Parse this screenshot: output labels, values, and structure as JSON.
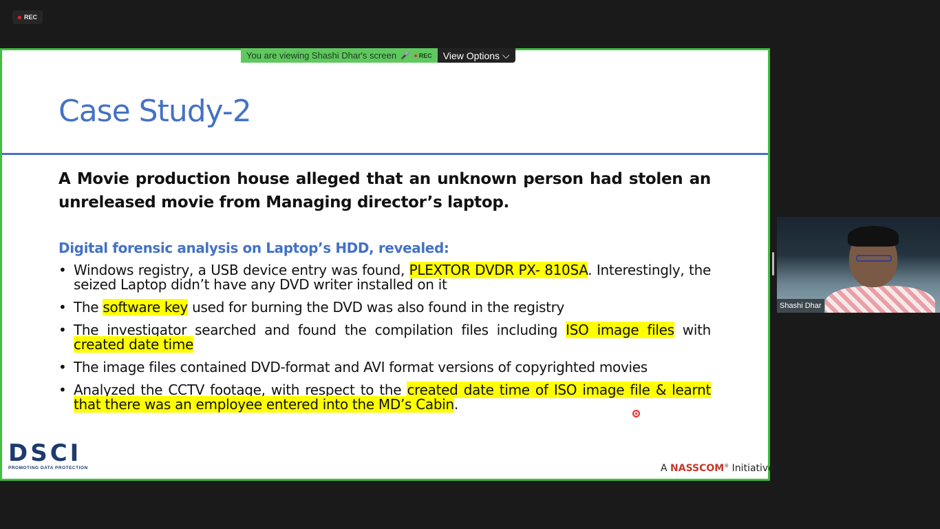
{
  "recording": {
    "label": "REC"
  },
  "share_bar": {
    "viewing_text": "You are viewing Shashi Dhar's screen",
    "rec_label": "REC",
    "view_options_label": "View Options",
    "view_options_chevron": "⌵"
  },
  "slide": {
    "title": "Case Study-2",
    "intro": "A Movie production house alleged that an unknown person had stolen an unreleased movie from Managing director’s laptop.",
    "subheading": "Digital forensic analysis on Laptop’s HDD, revealed:",
    "bullets": [
      {
        "a": "Windows registry, a USB device entry was found, ",
        "hl": "PLEXTOR DVDR PX- 810SA",
        "b": ". Interestingly, the seized Laptop didn’t have any DVD writer installed on it"
      },
      {
        "a": "The ",
        "hl": "software key",
        "b": " used for burning the DVD was also found in the registry"
      },
      {
        "a": "The investigator searched and found the compilation files including ",
        "hl": "ISO image files",
        "b": " with ",
        "hl2": "created date time",
        "c": ""
      },
      {
        "a": "The image files contained DVD-format and AVI format versions of copyrighted movies"
      },
      {
        "a": "Analyzed the CCTV footage, with respect to the ",
        "hl": "created date time of ISO image file & learnt that there was an employee entered into the MD’s Cabin",
        "b": "."
      }
    ],
    "logo_text": "DSCI",
    "logo_tagline": "PROMOTING DATA PROTECTION",
    "initiative_prefix": "A ",
    "initiative_brand": "NASSCOM",
    "initiative_mark": "®",
    "initiative_suffix": " Initiative"
  },
  "participant": {
    "name": "Shashi Dhar"
  },
  "colors": {
    "accent": "#4472c4",
    "share_border": "#3fbf3f",
    "highlight": "#ffff00"
  }
}
